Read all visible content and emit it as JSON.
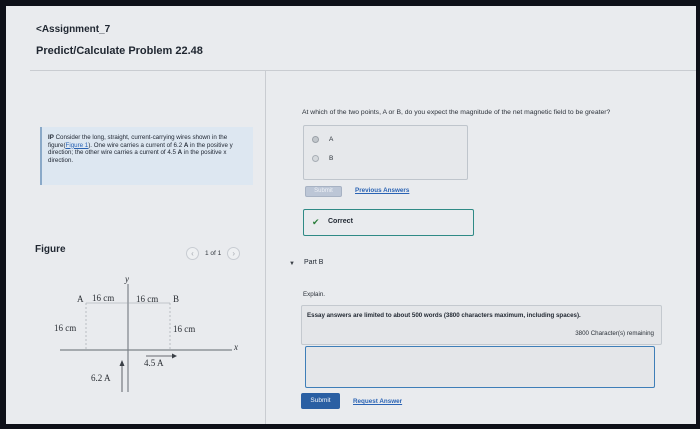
{
  "header": {
    "breadcrumb": "<Assignment_7",
    "title": "Predict/Calculate Problem 22.48"
  },
  "problem": {
    "prefix": "IP",
    "text_1": " Consider the long, straight, current-carrying wires shown in the figure(",
    "figure_link": "Figure 1",
    "text_2": "). One wire carries a current of 6.2 ",
    "unit_a1": "A",
    "text_3": " in the positive y direction; the other wire carries a current of 4.5 ",
    "unit_a2": "A",
    "text_4": " in the positive x direction."
  },
  "figure_panel": {
    "label": "Figure",
    "pager_text": "1 of 1",
    "prev_icon": "chevron-left-icon",
    "next_icon": "chevron-right-icon"
  },
  "figure": {
    "y_axis": "y",
    "x_axis": "x",
    "point_a": "A",
    "point_b": "B",
    "dist_a_horizontal": "16 cm",
    "dist_b_horizontal": "16 cm",
    "dist_a_vertical": "16 cm",
    "dist_b_vertical": "16 cm",
    "current_x": "4.5 A",
    "current_y": "6.2 A"
  },
  "part_a": {
    "question": "At which of the two points, A or B, do you expect the magnitude of the net magnetic field to be greater?",
    "options": [
      "A",
      "B"
    ],
    "selected": "A",
    "submit_label": "Submit",
    "previous_answers": "Previous Answers",
    "status": "Correct",
    "status_icon": "checkmark-icon"
  },
  "part_b": {
    "title": "Part B",
    "explain_label": "Explain.",
    "essay_note": "Essay answers are limited to about 500 words (3800 characters maximum, including spaces).",
    "char_remaining": "3800 Character(s) remaining",
    "answer_value": "",
    "submit_label": "Submit",
    "request_answer": "Request Answer"
  },
  "colors": {
    "accent": "#2a5fa3",
    "link": "#2a63b4",
    "correct": "#2f8a86"
  }
}
